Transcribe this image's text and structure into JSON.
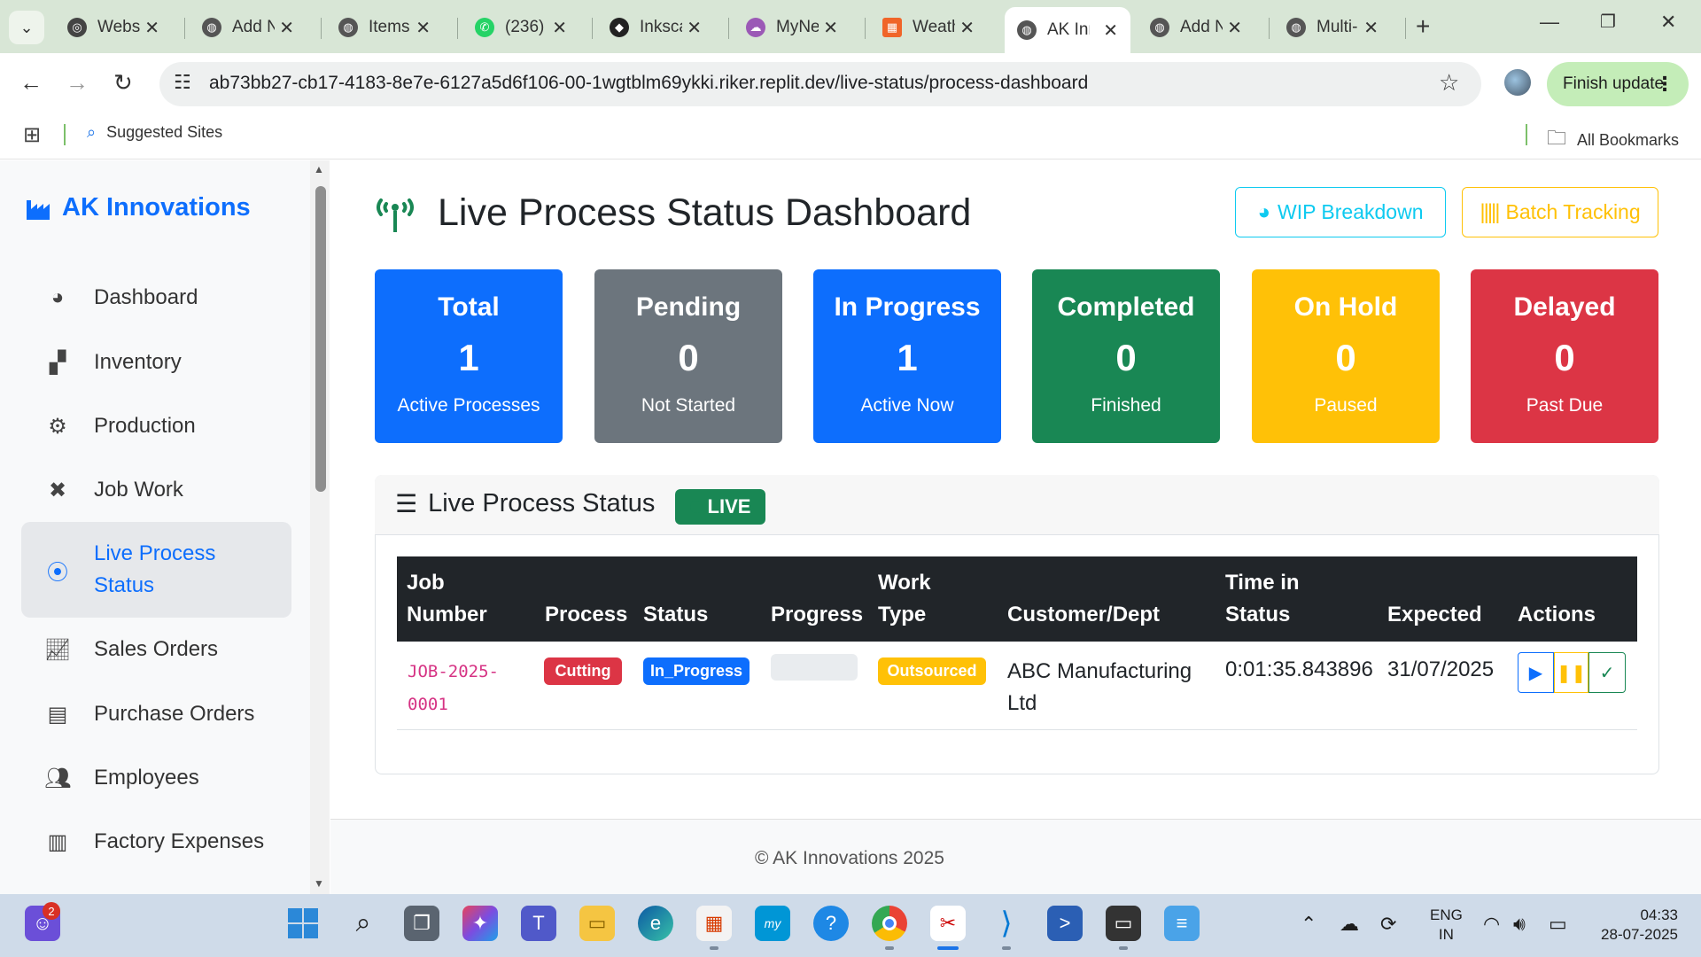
{
  "browser": {
    "tabs": [
      {
        "title": "Websi",
        "icon_color": "#444444"
      },
      {
        "title": "Add N",
        "icon_color": "#555555"
      },
      {
        "title": "Items",
        "icon_color": "#555555"
      },
      {
        "title": "(236)",
        "icon_color": "#25d366"
      },
      {
        "title": "Inksca",
        "icon_color": "#222222"
      },
      {
        "title": "MyNe",
        "icon_color": "#9b59b6"
      },
      {
        "title": "Weath",
        "icon_color": "#f06529"
      },
      {
        "title": "AK Inn",
        "icon_color": "#555555"
      },
      {
        "title": "Add N",
        "icon_color": "#555555"
      },
      {
        "title": "Multi-",
        "icon_color": "#555555"
      }
    ],
    "url": "ab73bb27-cb17-4183-8e7e-6127a5d6f106-00-1wgtblm69ykki.riker.replit.dev/live-status/process-dashboard",
    "finish_update_label": "Finish update",
    "bookmarks": {
      "suggested": "Suggested Sites",
      "all": "All Bookmarks"
    }
  },
  "sidebar": {
    "brand": "AK Innovations",
    "items": [
      {
        "label": "Dashboard",
        "icon": "palette-icon"
      },
      {
        "label": "Inventory",
        "icon": "boxes-icon"
      },
      {
        "label": "Production",
        "icon": "gears-icon"
      },
      {
        "label": "Job Work",
        "icon": "tools-icon"
      },
      {
        "label": "Live Process Status",
        "icon": "broadcast-icon"
      },
      {
        "label": "Sales Orders",
        "icon": "chart-line-icon"
      },
      {
        "label": "Purchase Orders",
        "icon": "document-icon"
      },
      {
        "label": "Employees",
        "icon": "users-icon"
      },
      {
        "label": "Factory Expenses",
        "icon": "receipt-icon"
      }
    ]
  },
  "page": {
    "title": "Live Process Status Dashboard",
    "wip_label": "WIP Breakdown",
    "batch_label": "Batch Tracking"
  },
  "stats": [
    {
      "title": "Total",
      "value": "1",
      "sub": "Active Processes",
      "color": "#0d6efd"
    },
    {
      "title": "Pending",
      "value": "0",
      "sub": "Not Started",
      "color": "#6c757d"
    },
    {
      "title": "In Progress",
      "value": "1",
      "sub": "Active Now",
      "color": "#0d6efd"
    },
    {
      "title": "Completed",
      "value": "0",
      "sub": "Finished",
      "color": "#198754"
    },
    {
      "title": "On Hold",
      "value": "0",
      "sub": "Paused",
      "color": "#ffc107"
    },
    {
      "title": "Delayed",
      "value": "0",
      "sub": "Past Due",
      "color": "#dc3545"
    }
  ],
  "panel": {
    "title": "Live Process Status",
    "live_badge": "LIVE"
  },
  "table": {
    "headers": {
      "job_1": "Job",
      "job_2": "Number",
      "process": "Process",
      "status": "Status",
      "progress": "Progress",
      "work_1": "Work",
      "work_2": "Type",
      "customer": "Customer/Dept",
      "time_1": "Time in",
      "time_2": "Status",
      "expected": "Expected",
      "actions": "Actions"
    },
    "row": {
      "job_1": "JOB-2025-",
      "job_2": "0001",
      "process": "Cutting",
      "status": "In_Progress",
      "progress": 0,
      "work_type": "Outsourced",
      "customer_1": "ABC Manufacturing",
      "customer_2": "Ltd",
      "time_in_status": "0:01:35.843896",
      "expected": "31/07/2025"
    }
  },
  "footer": "© AK Innovations 2025",
  "taskbar": {
    "notification_count": "2",
    "lang_1": "ENG",
    "lang_2": "IN",
    "time": "04:33",
    "date": "28-07-2025"
  }
}
